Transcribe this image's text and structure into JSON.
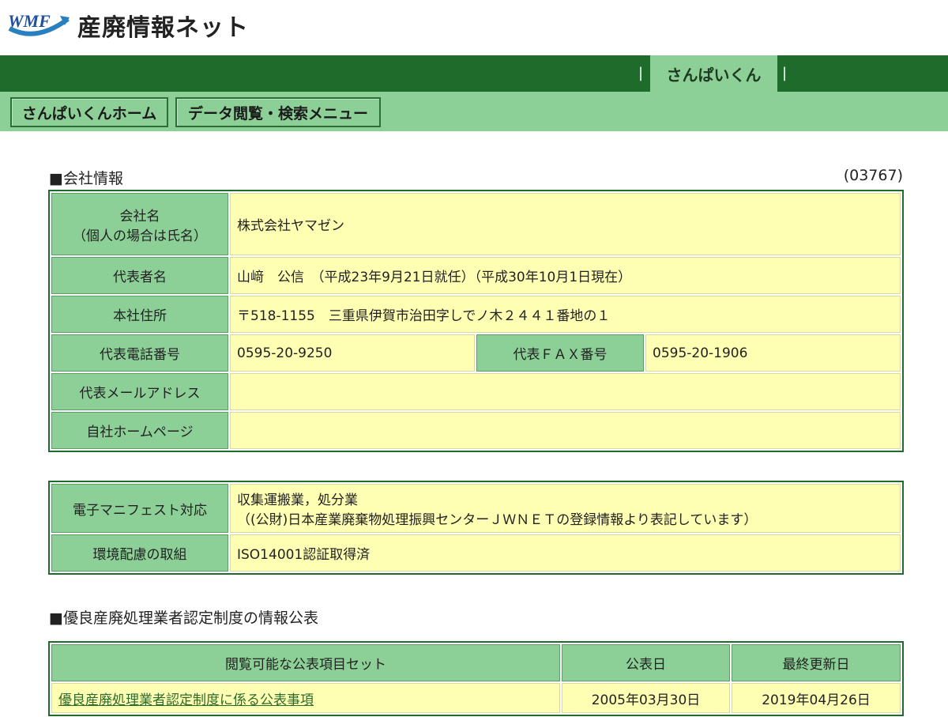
{
  "site": {
    "logo_text": "WMF",
    "title": "産廃情報ネット"
  },
  "topnav": {
    "active_tab": "さんぱいくん",
    "separator": "|"
  },
  "subnav": {
    "home_button": "さんぱいくんホーム",
    "menu_button": "データ閲覧・検索メニュー"
  },
  "company": {
    "heading": "■会社情報",
    "id": "(03767)",
    "name_label_1": "会社名",
    "name_label_2": "（個人の場合は氏名）",
    "name_value": "株式会社ヤマゼン",
    "rep_label": "代表者名",
    "rep_value": "山﨑　公信　（平成23年9月21日就任）（平成30年10月1日現在）",
    "address_label": "本社住所",
    "address_value": "〒518-1155　三重県伊賀市治田字しでノ木２４４１番地の１",
    "phone_label": "代表電話番号",
    "phone_value": "0595-20-9250",
    "fax_label": "代表ＦＡＸ番号",
    "fax_value": "0595-20-1906",
    "email_label": "代表メールアドレス",
    "email_value": "",
    "homepage_label": "自社ホームページ",
    "homepage_value": ""
  },
  "extra": {
    "manifest_label": "電子マニフェスト対応",
    "manifest_value_1": "収集運搬業，処分業",
    "manifest_value_2": "（(公財)日本産業廃棄物処理振興センターＪＷＮＥＴの登録情報より表記しています）",
    "env_label": "環境配慮の取組",
    "env_value": "ISO14001認証取得済"
  },
  "disclosure": {
    "heading": "■優良産廃処理業者認定制度の情報公表",
    "col_set": "閲覧可能な公表項目セット",
    "col_published": "公表日",
    "col_updated": "最終更新日",
    "row_link": "優良産廃処理業者認定制度に係る公表事項",
    "row_published": "2005年03月30日",
    "row_updated": "2019年04月26日"
  }
}
